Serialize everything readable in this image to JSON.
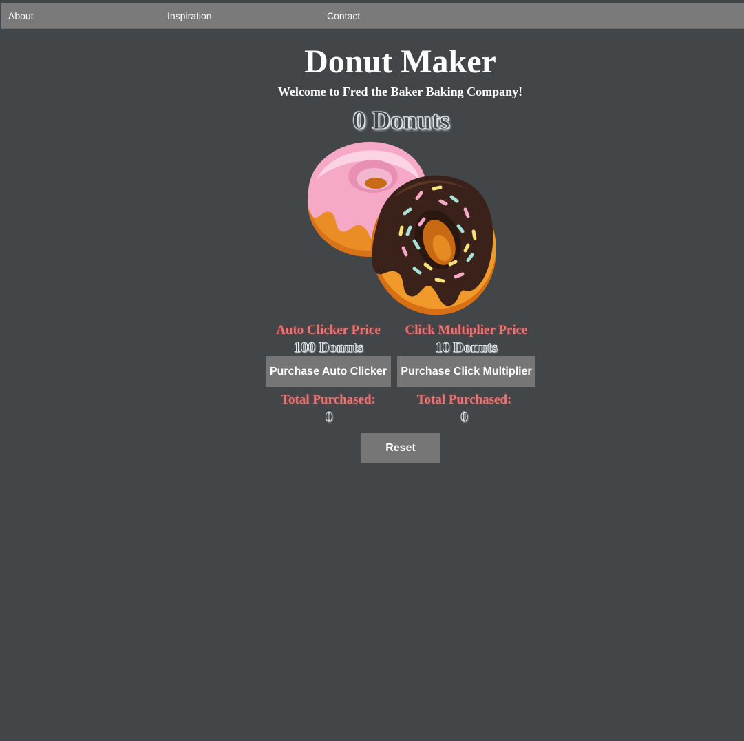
{
  "nav": {
    "about": "About",
    "inspiration": "Inspiration",
    "contact": "Contact"
  },
  "header": {
    "title": "Donut Maker",
    "subtitle": "Welcome to Fred the Baker Baking Company!"
  },
  "counter": {
    "donuts": "0 Donuts"
  },
  "donut_image": {
    "icon": "donut-image",
    "colors": {
      "pink_frosting": "#f8a9c8",
      "chocolate_frosting": "#3d241b",
      "dough": "#e98b22"
    }
  },
  "auto_clicker": {
    "price_label": "Auto Clicker Price",
    "price_value": "100 Donuts",
    "button_label": "Purchase Auto Clicker",
    "total_label": "Total Purchased:",
    "total_value": "0"
  },
  "click_multiplier": {
    "price_label": "Click Multiplier Price",
    "price_value": "10 Donuts",
    "button_label": "Purchase Click Multiplier",
    "total_label": "Total Purchased:",
    "total_value": "0"
  },
  "reset": {
    "label": "Reset"
  },
  "colors": {
    "background": "#424649",
    "navbar": "#7a7a7a",
    "button": "#767676",
    "price_label": "#e07a7a"
  }
}
